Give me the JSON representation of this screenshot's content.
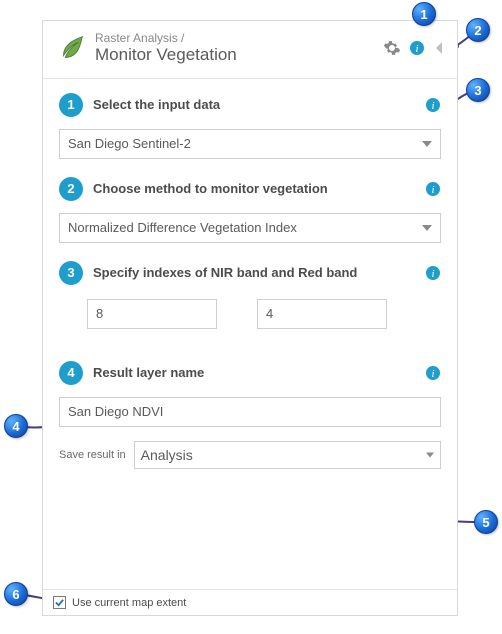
{
  "header": {
    "breadcrumb": "Raster Analysis /",
    "title": "Monitor Vegetation"
  },
  "steps": {
    "s1": {
      "num": "1",
      "label": "Select the input data"
    },
    "s2": {
      "num": "2",
      "label": "Choose method to monitor vegetation"
    },
    "s3": {
      "num": "3",
      "label": "Specify indexes of NIR band and Red band"
    },
    "s4": {
      "num": "4",
      "label": "Result layer name"
    }
  },
  "inputs": {
    "input_layer": "San Diego Sentinel-2",
    "method": "Normalized Difference Vegetation Index",
    "nir_band": "8",
    "red_band": "4",
    "result_name": "San Diego NDVI",
    "save_in_label": "Save result in",
    "save_in_value": "Analysis"
  },
  "footer": {
    "use_extent_label": "Use current map extent",
    "use_extent_checked": true
  },
  "callouts": {
    "c1": "1",
    "c2": "2",
    "c3": "3",
    "c4": "4",
    "c5": "5",
    "c6": "6"
  }
}
